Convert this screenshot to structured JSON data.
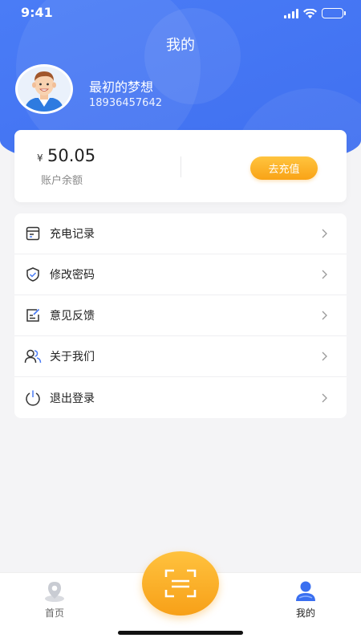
{
  "status_bar": {
    "time": "9:41"
  },
  "header": {
    "title": "我的"
  },
  "profile": {
    "name": "最初的梦想",
    "phone": "18936457642"
  },
  "wallet": {
    "currency_symbol": "¥",
    "balance": "50.05",
    "balance_label": "账户余额",
    "recharge_label": "去充值"
  },
  "menu": {
    "items": [
      {
        "label": "充电记录",
        "icon": "charging-record-icon"
      },
      {
        "label": "修改密码",
        "icon": "shield-check-icon"
      },
      {
        "label": "意见反馈",
        "icon": "feedback-edit-icon"
      },
      {
        "label": "关于我们",
        "icon": "users-icon"
      },
      {
        "label": "退出登录",
        "icon": "power-icon"
      }
    ]
  },
  "tabbar": {
    "home_label": "首页",
    "mine_label": "我的",
    "scan_icon": "scan-icon"
  },
  "colors": {
    "primary": "#4a7cf6",
    "accent": "#f9a316",
    "background": "#f4f4f6"
  }
}
